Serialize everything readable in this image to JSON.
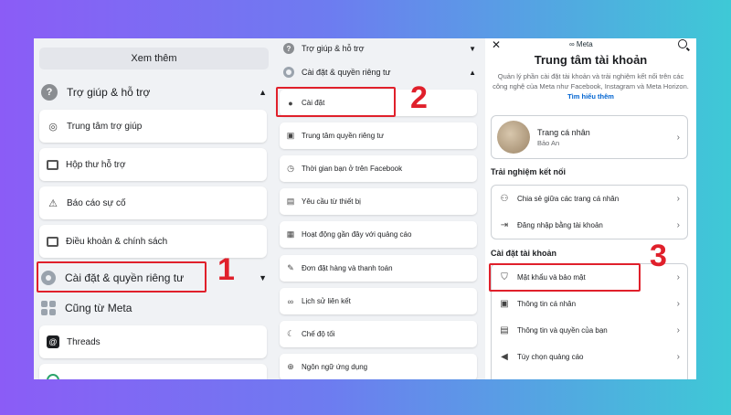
{
  "panel1": {
    "see_more": "Xem thêm",
    "help": {
      "label": "Trợ giúp & hỗ trợ",
      "chevron": "^",
      "icon": "question-icon"
    },
    "help_items": [
      {
        "label": "Trung tâm trợ giúp",
        "icon": "lifebuoy-icon"
      },
      {
        "label": "Hộp thư hỗ trợ",
        "icon": "inbox-icon"
      },
      {
        "label": "Báo cáo sự cố",
        "icon": "warning-icon"
      },
      {
        "label": "Điều khoản & chính sách",
        "icon": "book-icon"
      }
    ],
    "settings": {
      "label": "Cài đặt & quyền riêng tư",
      "chevron": "v"
    },
    "meta": {
      "label": "Cũng từ Meta"
    },
    "meta_items": [
      {
        "label": "Threads",
        "icon": "threads-icon"
      }
    ]
  },
  "panel2": {
    "help": {
      "label": "Trợ giúp & hỗ trợ",
      "chevron": "v"
    },
    "settings": {
      "label": "Cài đặt & quyền riêng tư",
      "chevron": "^"
    },
    "items": [
      {
        "label": "Cài đặt",
        "icon": "account-icon"
      },
      {
        "label": "Trung tâm quyền riêng tư",
        "icon": "lock-icon"
      },
      {
        "label": "Thời gian bạn ở trên Facebook",
        "icon": "clock-icon"
      },
      {
        "label": "Yêu cầu từ thiết bị",
        "icon": "device-icon"
      },
      {
        "label": "Hoạt động gần đây với quảng cáo",
        "icon": "ads-icon"
      },
      {
        "label": "Đơn đặt hàng và thanh toán",
        "icon": "pen-icon"
      },
      {
        "label": "Lịch sử liên kết",
        "icon": "link-icon"
      },
      {
        "label": "Chế độ tối",
        "icon": "moon-icon"
      },
      {
        "label": "Ngôn ngữ ứng dụng",
        "icon": "globe-icon"
      }
    ]
  },
  "panel3": {
    "logo": "∞ Meta",
    "title": "Trung tâm tài khoản",
    "description": "Quản lý phần cài đặt tài khoản và trải nghiệm kết nối trên các công nghệ của Meta như Facebook, Instagram và Meta Horizon.",
    "learn_more": "Tìm hiểu thêm",
    "profile": {
      "title": "Trang cá nhân",
      "name": "Bảo An"
    },
    "connected_heading": "Trải nghiệm kết nối",
    "connected": [
      {
        "label": "Chia sẻ giữa các trang cá nhân",
        "icon": "share-icon"
      },
      {
        "label": "Đăng nhập bằng tài khoản",
        "icon": "login-icon"
      }
    ],
    "account_heading": "Cài đặt tài khoản",
    "account": [
      {
        "label": "Mật khẩu và bảo mật",
        "icon": "shield-icon"
      },
      {
        "label": "Thông tin cá nhân",
        "icon": "id-card-icon"
      },
      {
        "label": "Thông tin và quyền của bạn",
        "icon": "document-icon"
      },
      {
        "label": "Tùy chọn quảng cáo",
        "icon": "megaphone-icon"
      }
    ]
  },
  "annotations": {
    "step1": "1",
    "step2": "2",
    "step3": "3"
  },
  "colors": {
    "highlight": "#e0202b",
    "link": "#0064d1"
  }
}
